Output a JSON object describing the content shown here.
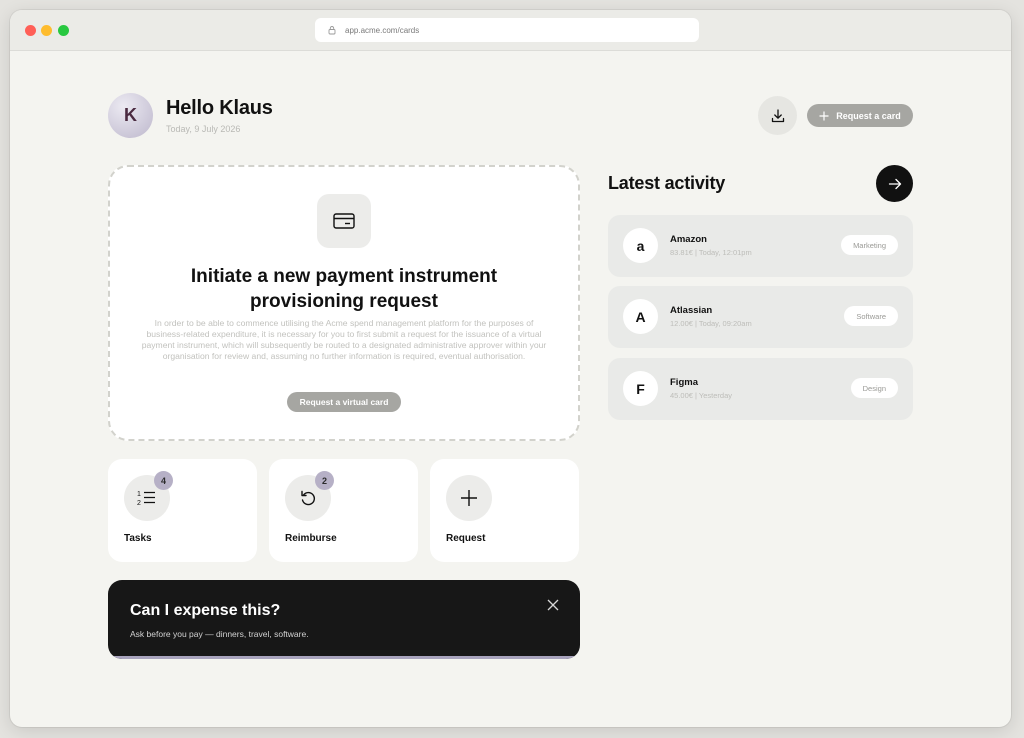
{
  "browser": {
    "url": "app.acme.com/cards"
  },
  "header": {
    "avatar_initial": "K",
    "greeting": "Hello Klaus",
    "date": "Today, 9 July 2026",
    "request_card_label": "Request a card"
  },
  "hero": {
    "title": "Initiate a new payment instrument provisioning request",
    "body": "In order to be able to commence utilising the Acme spend management platform for the purposes of business-related expenditure, it is necessary for you to first submit a request for the issuance of a virtual payment instrument, which will subsequently be routed to a designated administrative approver within your organisation for review and, assuming no further information is required, eventual authorisation.",
    "button_label": "Request a virtual card"
  },
  "tiles": [
    {
      "label": "Tasks",
      "badge": "4",
      "icon": "list-icon"
    },
    {
      "label": "Reimburse",
      "badge": "2",
      "icon": "undo-icon"
    },
    {
      "label": "Request",
      "badge": "",
      "icon": "plus-icon"
    }
  ],
  "promo": {
    "title": "Can I expense this?",
    "subtitle": "Ask before you pay — dinners, travel, software."
  },
  "activity": {
    "title": "Latest activity",
    "items": [
      {
        "initial": "a",
        "name": "Amazon",
        "meta": "83.81€ | Today, 12:01pm",
        "tag": "Marketing"
      },
      {
        "initial": "A",
        "name": "Atlassian",
        "meta": "12.00€ | Today, 09:20am",
        "tag": "Software"
      },
      {
        "initial": "F",
        "name": "Figma",
        "meta": "45.00€ | Yesterday",
        "tag": "Design"
      }
    ]
  },
  "colors": {
    "background": "#f4f4f0",
    "accent_badge": "#b6b0c6",
    "button_disabled": "#a6a6a2",
    "promo_bg": "#171717"
  }
}
